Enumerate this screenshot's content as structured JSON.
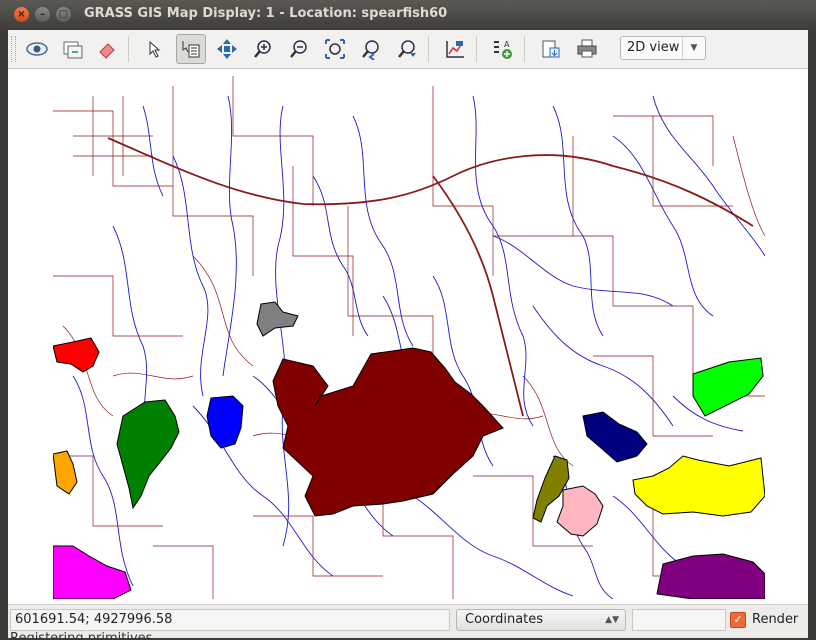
{
  "window": {
    "title": "GRASS GIS Map Display: 1  - Location: spearfish60"
  },
  "toolbar": {
    "view_mode": "2D view",
    "buttons": [
      {
        "name": "display-map-icon"
      },
      {
        "name": "render-map-icon"
      },
      {
        "name": "erase-display-icon"
      },
      {
        "name": "pointer-icon"
      },
      {
        "name": "query-icon"
      },
      {
        "name": "pan-icon"
      },
      {
        "name": "zoom-in-icon"
      },
      {
        "name": "zoom-out-icon"
      },
      {
        "name": "zoom-extent-icon"
      },
      {
        "name": "zoom-back-icon"
      },
      {
        "name": "zoom-options-icon"
      },
      {
        "name": "analyze-icon"
      },
      {
        "name": "decoration-icon"
      },
      {
        "name": "save-icon"
      },
      {
        "name": "print-icon"
      }
    ]
  },
  "statusbar": {
    "coordinates": "601691.54; 4927996.58",
    "display_mode": "Coordinates",
    "render_label": "Render",
    "message": "Registering primitives"
  },
  "map": {
    "colors": {
      "roads": "#8b1a1a",
      "streams": "#1a1acc",
      "soil_main": "#800000"
    }
  }
}
